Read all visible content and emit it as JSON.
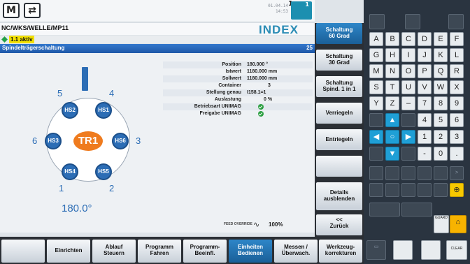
{
  "topbar": {
    "mode_icon": "M",
    "cycle_icon": "⇄",
    "date": "01.04.14",
    "time": "14:53",
    "channel_number": "1",
    "node": "1"
  },
  "pathbar": {
    "program_path": "NC/WKS/WELLE/MP11",
    "brand": "INDEX"
  },
  "statusbar": {
    "channel_text": "1.1 aktiv"
  },
  "window": {
    "title": "Spindelträgerschaltung",
    "number": "25"
  },
  "carrier": {
    "angle_text": "180.0°",
    "position_labels": [
      "5",
      "4",
      "6",
      "3",
      "1",
      "2"
    ],
    "spindles": [
      {
        "name": "HS2"
      },
      {
        "name": "HS1"
      },
      {
        "name": "HS3"
      },
      {
        "name": "HS6"
      },
      {
        "name": "HS4"
      },
      {
        "name": "HS5"
      }
    ],
    "active_spindle": "TR1"
  },
  "data_table": [
    {
      "label": "Position",
      "value": "180.000 °"
    },
    {
      "label": "Istwert",
      "value": "1180.000 mm"
    },
    {
      "label": "Sollwert",
      "value": "1180.000 mm"
    },
    {
      "label": "Container",
      "value": "3"
    },
    {
      "label": "Stellung genau",
      "value": "I158.1=1"
    },
    {
      "label": "Auslastung",
      "value": "0 %"
    },
    {
      "label": "Betriebsart UNIMAG",
      "value": "ok"
    },
    {
      "label": "Freigabe UNIMAG",
      "value": "ok"
    }
  ],
  "feed": {
    "label": "FEED OVERRIDE",
    "value": "100%"
  },
  "vertical_softkeys": [
    {
      "line1": "Schaltung",
      "line2": "60 Grad",
      "active": true
    },
    {
      "line1": "Schaltung",
      "line2": "30 Grad",
      "active": false
    },
    {
      "line1": "Schaltung",
      "line2": "Spind. 1 in 1",
      "active": false
    },
    {
      "line1": "Verriegeln",
      "line2": "",
      "active": false
    },
    {
      "line1": "Entriegeln",
      "line2": "",
      "active": false
    },
    {
      "line1": "",
      "line2": "",
      "active": false
    },
    {
      "line1": "Details",
      "line2": "ausblenden",
      "active": false
    },
    {
      "line1": "<<",
      "line2": "Zurück",
      "active": false
    }
  ],
  "horizontal_softkeys": [
    {
      "line1": "",
      "line2": "",
      "active": false
    },
    {
      "line1": "Einrichten",
      "line2": "",
      "active": false
    },
    {
      "line1": "Ablauf",
      "line2": "Steuern",
      "active": false
    },
    {
      "line1": "Programm",
      "line2": "Fahren",
      "active": false
    },
    {
      "line1": "Programm-",
      "line2": "Beeinfl.",
      "active": false
    },
    {
      "line1": "Einheiten",
      "line2": "Bedienen",
      "active": true
    },
    {
      "line1": "Messen /",
      "line2": "Überwach.",
      "active": false
    },
    {
      "line1": "Werkzeug-",
      "line2": "korrekturen",
      "active": false
    }
  ],
  "keypad": {
    "letters_row1": [
      "A",
      "B",
      "C",
      "D",
      "E",
      "F"
    ],
    "letters_row2": [
      "G",
      "H",
      "I",
      "J",
      "K",
      "L"
    ],
    "letters_row3": [
      "M",
      "N",
      "O",
      "P",
      "Q",
      "R"
    ],
    "letters_row4": [
      "S",
      "T",
      "U",
      "V",
      "W",
      "X"
    ],
    "letters_row5": [
      "Y",
      "Z",
      "–"
    ],
    "digits": [
      "7",
      "8",
      "9",
      "4",
      "5",
      "6",
      "1",
      "2",
      "3",
      "-",
      "0",
      "."
    ],
    "guard_label": "GUARD",
    "clear_label": "CLEAR"
  }
}
